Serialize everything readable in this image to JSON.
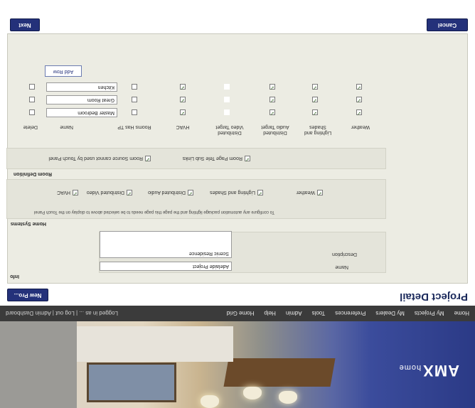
{
  "brand": {
    "logo": "AMX",
    "logo_sub": "home"
  },
  "nav": {
    "links": [
      "Home",
      "My Projects",
      "My Dealers",
      "Preferences",
      "Tools",
      "Admin",
      "Help",
      "Home Grid"
    ],
    "user": "Logged in as ... | Log out | Admin Dashboard"
  },
  "page": {
    "title": "Project Detail",
    "new_button": "New Pro...",
    "cancel_button": "Cancel",
    "next_button": "Next"
  },
  "info": {
    "section": "Info",
    "name_label": "Name",
    "name_value": "Adelaide Project",
    "description_label": "Description",
    "description_value": "Scenic Residence"
  },
  "home_systems": {
    "section": "Home Systems",
    "note": "To configure any automation package lighting and the page this page needs to be selected above to display on the Touch Panel",
    "options": [
      {
        "label": "HVAC",
        "checked": true
      },
      {
        "label": "Distributed Video",
        "checked": true
      },
      {
        "label": "Distributed Audio",
        "checked": true
      },
      {
        "label": "Lighting and Shades",
        "checked": true
      },
      {
        "label": "Weather",
        "checked": true
      }
    ]
  },
  "room_definition": {
    "section": "Room Definition",
    "options": [
      {
        "label": "Room Source cannot used by Touch Panel",
        "checked": true
      },
      {
        "label": "Room Page Tele Sub Links",
        "checked": true
      }
    ]
  },
  "rooms": {
    "delete_header": "Delete",
    "name_header": "Name",
    "columns": [
      "Rooms Has TP",
      "HVAC",
      "Distributed Video Target",
      "Distributed Audio Target",
      "Lighting and Shades",
      "Weather"
    ],
    "rows": [
      {
        "name": "Master Bedroom",
        "has_tp": false,
        "hvac": true,
        "video": false,
        "audio": true,
        "lighting": true,
        "weather": true
      },
      {
        "name": "Great Room",
        "has_tp": false,
        "hvac": true,
        "video": false,
        "audio": true,
        "lighting": true,
        "weather": true
      },
      {
        "name": "Kitchen",
        "has_tp": false,
        "hvac": true,
        "video": false,
        "audio": true,
        "lighting": true,
        "weather": true
      }
    ],
    "add_button": "Add Row"
  }
}
